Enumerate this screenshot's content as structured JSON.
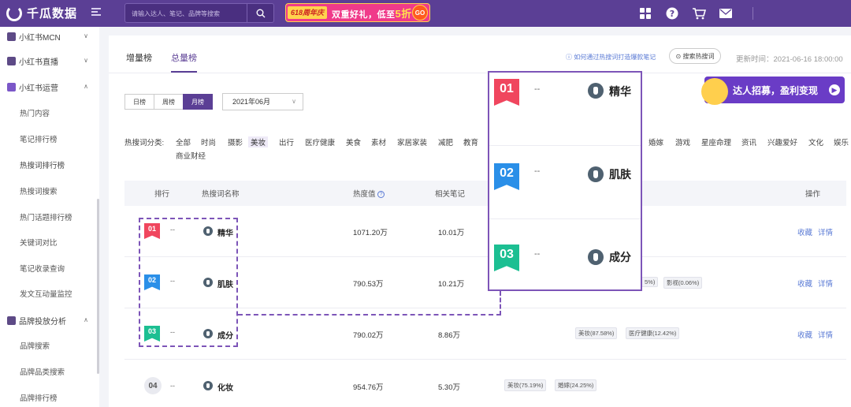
{
  "header": {
    "brand": "千瓜数据",
    "search_placeholder": "请输入达人、笔记、品牌等搜索",
    "promo": {
      "badge": "618周年庆",
      "text_prefix": "双重好礼，低至",
      "discount": "5折",
      "go": "GO"
    }
  },
  "sidebar": {
    "sections": [
      {
        "label": "小红书MCN",
        "expanded": false
      },
      {
        "label": "小红书直播",
        "expanded": false
      },
      {
        "label": "小红书运营",
        "expanded": true
      },
      {
        "label": "品牌投放分析",
        "expanded": true
      }
    ],
    "ops_items": [
      "热门内容",
      "笔记排行榜",
      "热搜词排行榜",
      "热搜词搜索",
      "热门话题排行榜",
      "关键词对比",
      "笔记收录查询",
      "发文互动量监控"
    ],
    "brand_items": [
      "品牌搜索",
      "品牌品类搜索",
      "品牌排行榜"
    ]
  },
  "main": {
    "tabs": [
      "增量榜",
      "总量榜"
    ],
    "active_tab": "总量榜",
    "help_link": "如何通过热搜词打造爆款笔记",
    "search_hot_button": "搜索热搜词",
    "update_time": "更新时间：2021-06-16 18:00:00",
    "period": [
      "日榜",
      "周榜",
      "月榜"
    ],
    "active_period": "月榜",
    "month": "2021年06月",
    "banner": "达人招募，盈利变现",
    "category_label": "热搜词分类:",
    "categories_left": [
      "全部",
      "时尚",
      "摄影",
      "美妆",
      "出行",
      "医疗健康",
      "美食",
      "素材",
      "家居家装",
      "减肥",
      "教育"
    ],
    "active_category": "美妆",
    "categories_right": [
      "婚嫁",
      "游戏",
      "星座命理",
      "资讯",
      "兴趣爱好",
      "文化",
      "娱乐"
    ],
    "categories_row2": [
      "商业财经"
    ],
    "columns": {
      "rank": "排行",
      "name": "热搜词名称",
      "heat": "热度值",
      "notes": "相关笔记",
      "action": "操作"
    },
    "rows": [
      {
        "rank": "01",
        "dash": "--",
        "keyword": "精华",
        "heat": "1071.20万",
        "notes": "10.01万",
        "tags": [],
        "actions": [
          "收藏",
          "详情"
        ]
      },
      {
        "rank": "02",
        "dash": "--",
        "keyword": "肌肤",
        "heat": "790.53万",
        "notes": "10.21万",
        "tags": [
          "5%)",
          "影视(0.06%)"
        ],
        "actions": [
          "收藏",
          "详情"
        ]
      },
      {
        "rank": "03",
        "dash": "--",
        "keyword": "成分",
        "heat": "790.02万",
        "notes": "8.86万",
        "tags": [
          "美妆(87.58%)",
          "医疗健康(12.42%)"
        ],
        "actions": [
          "收藏",
          "详情"
        ]
      },
      {
        "rank": "04",
        "dash": "--",
        "keyword": "化妆",
        "heat": "954.76万",
        "notes": "5.30万",
        "tags": [
          "美妆(75.19%)",
          "婚嫁(24.25%)"
        ],
        "actions": []
      }
    ]
  },
  "colors": {
    "brand_purple": "#5b3f95",
    "rank1": "#f0465e",
    "rank2": "#2a8fe8",
    "rank3": "#1cbf92",
    "link_blue": "#5b7bd5"
  }
}
